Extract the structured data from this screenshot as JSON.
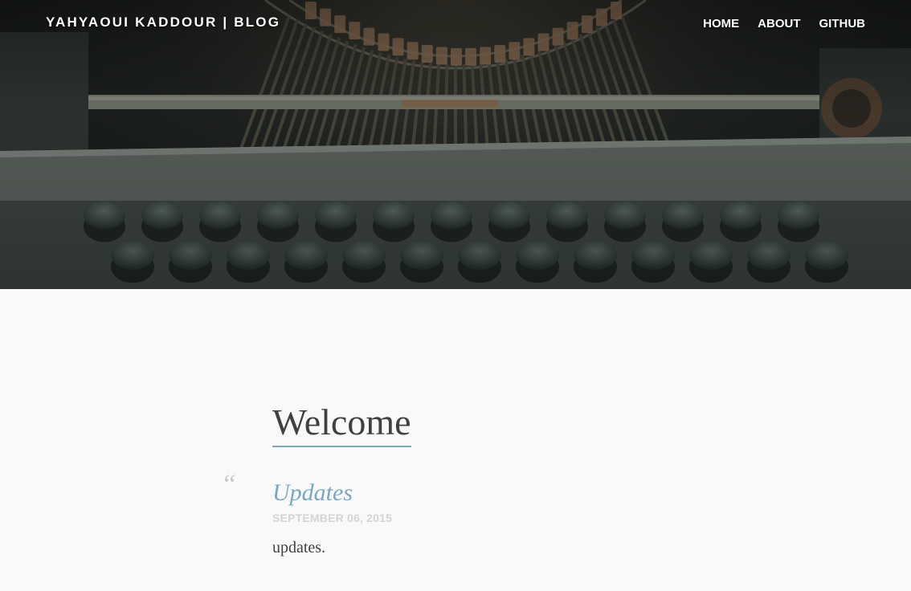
{
  "header": {
    "brand": "YAHYAOUI KADDOUR | BLOG",
    "nav": [
      {
        "label": "HOME"
      },
      {
        "label": "ABOUT"
      },
      {
        "label": "GITHUB"
      }
    ],
    "hero_image": "vintage-typewriter-photo"
  },
  "main": {
    "page_title": "Welcome",
    "quote_icon": "quote-icon",
    "posts": [
      {
        "title": "Updates",
        "date": "SEPTEMBER 06, 2015",
        "excerpt": "updates."
      }
    ]
  },
  "colors": {
    "accent": "#7ba7c1",
    "text": "#404040",
    "muted": "#d4d4d4",
    "background": "#f9f9f9"
  }
}
